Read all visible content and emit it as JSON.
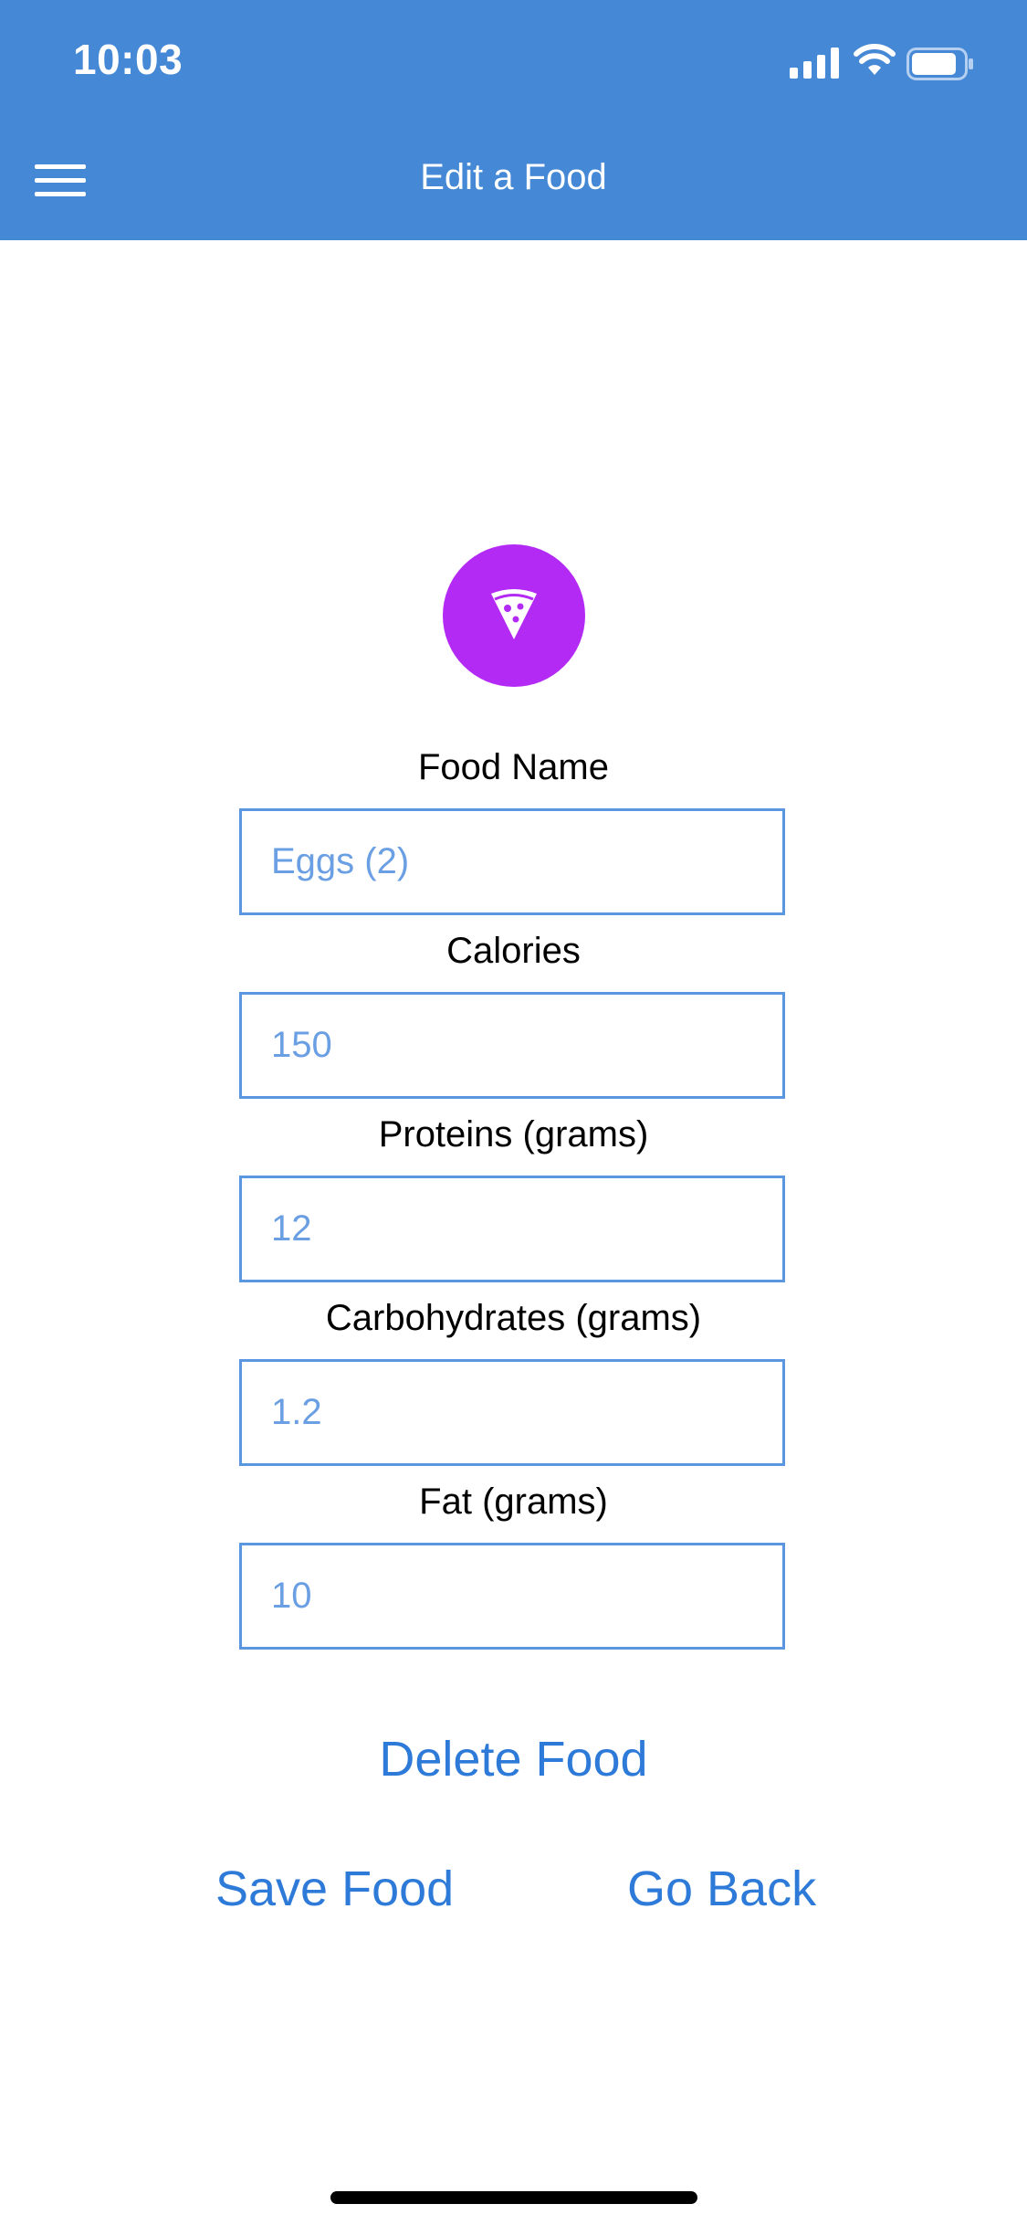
{
  "status_bar": {
    "time": "10:03",
    "icons": [
      "signal-icon",
      "wifi-icon",
      "battery-icon"
    ]
  },
  "nav": {
    "menu_icon": "hamburger-menu-icon",
    "title": "Edit a Food"
  },
  "food_icon": {
    "name": "pizza-slice-icon",
    "background": "#b32af5"
  },
  "form": {
    "food_name": {
      "label": "Food Name",
      "value": "Eggs (2)"
    },
    "calories": {
      "label": "Calories",
      "value": "150"
    },
    "proteins": {
      "label": "Proteins (grams)",
      "value": "12"
    },
    "carbohydrates": {
      "label": "Carbohydrates (grams)",
      "value": "1.2"
    },
    "fat": {
      "label": "Fat (grams)",
      "value": "10"
    }
  },
  "actions": {
    "delete": "Delete Food",
    "save": "Save Food",
    "back": "Go Back"
  },
  "colors": {
    "header": "#4488d6",
    "accent": "#2d7ad8",
    "input_border": "#5b97e0",
    "input_text": "#6a9fe3"
  }
}
